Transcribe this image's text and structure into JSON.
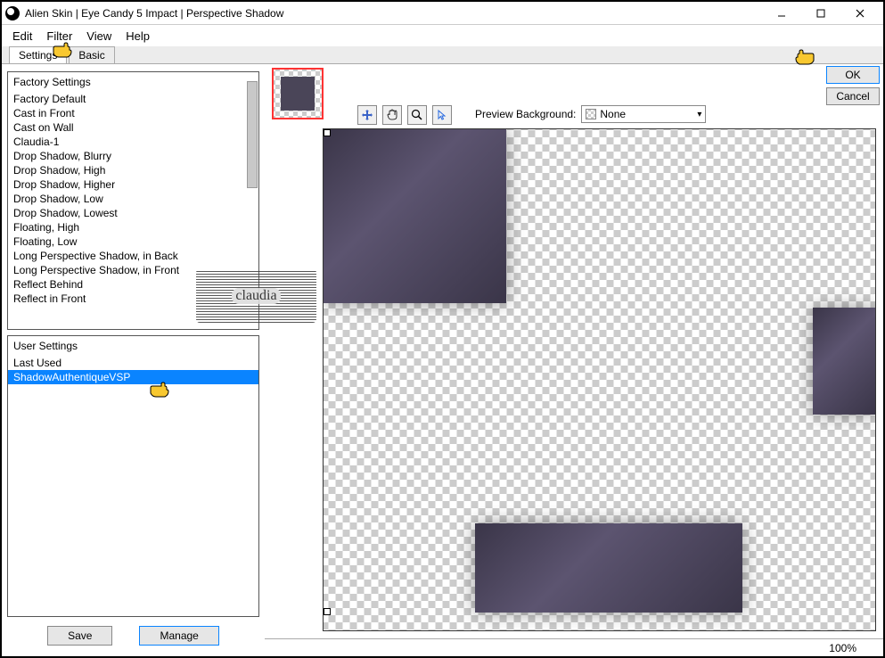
{
  "titlebar": {
    "text": "Alien Skin | Eye Candy 5 Impact | Perspective Shadow"
  },
  "menubar": {
    "edit": "Edit",
    "filter": "Filter",
    "view": "View",
    "help": "Help"
  },
  "tabs": {
    "settings": "Settings",
    "basic": "Basic"
  },
  "factory_settings": {
    "header": "Factory Settings",
    "items": [
      "Factory Default",
      "Cast in Front",
      "Cast on Wall",
      "Claudia-1",
      "Drop Shadow, Blurry",
      "Drop Shadow, High",
      "Drop Shadow, Higher",
      "Drop Shadow, Low",
      "Drop Shadow, Lowest",
      "Floating, High",
      "Floating, Low",
      "Long Perspective Shadow, in Back",
      "Long Perspective Shadow, in Front",
      "Reflect Behind",
      "Reflect in Front"
    ]
  },
  "user_settings": {
    "header": "User Settings",
    "items": [
      {
        "label": "Last Used",
        "selected": false
      },
      {
        "label": "ShadowAuthentiqueVSP",
        "selected": true
      }
    ]
  },
  "buttons": {
    "save": "Save",
    "manage": "Manage",
    "ok": "OK",
    "cancel": "Cancel"
  },
  "preview": {
    "label": "Preview Background:",
    "selected": "None"
  },
  "status": {
    "zoom": "100%"
  },
  "watermark": {
    "text": "claudia"
  }
}
